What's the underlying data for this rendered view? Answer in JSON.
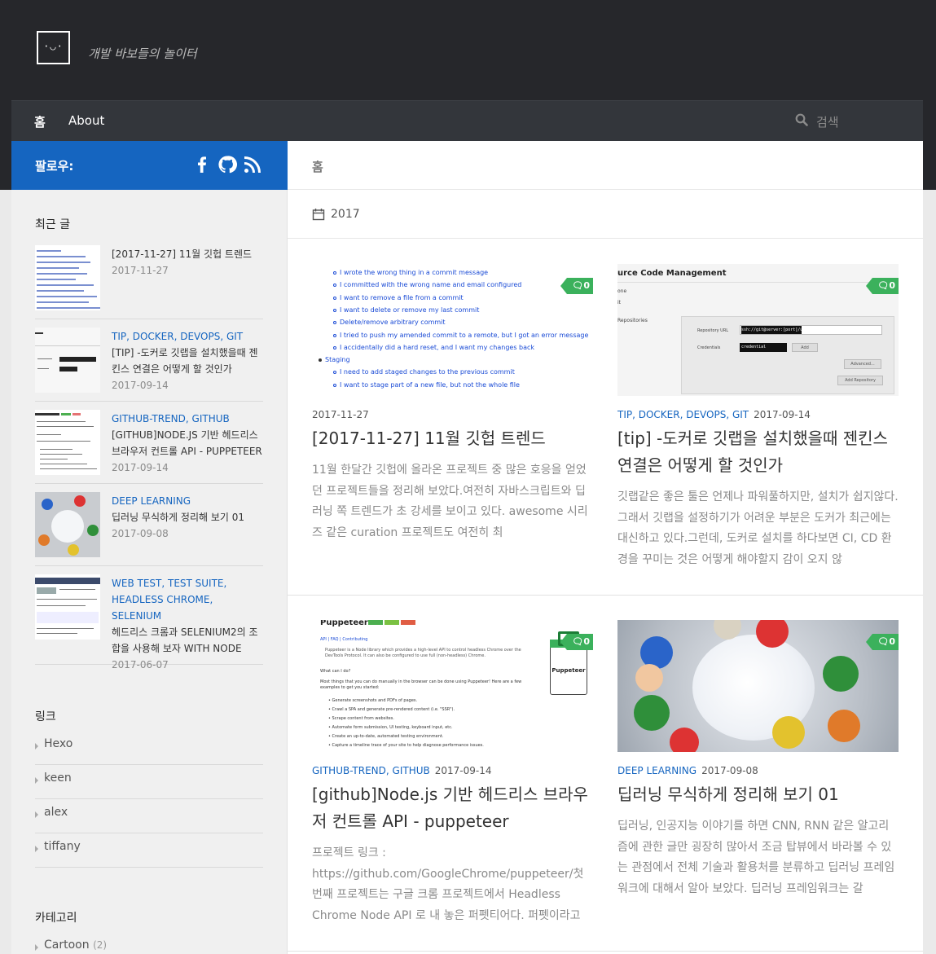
{
  "site": {
    "logo_text": "·◡·",
    "description": "개발 바보들의 놀이터"
  },
  "nav": {
    "home": "홈",
    "about": "About",
    "search_placeholder": "검색"
  },
  "follow": {
    "label": "팔로우:",
    "icons": [
      "facebook-icon",
      "github-icon",
      "rss-icon"
    ]
  },
  "sidebar": {
    "recent_heading": "최근 글",
    "recent": [
      {
        "category": "",
        "title": "[2017-11-27] 11월 깃헙 트렌드",
        "date": "2017-11-27"
      },
      {
        "category": "TIP, DOCKER, DEVOPS, GIT",
        "title": "[TIP] -도커로 깃랩을 설치했을때 젠킨스 연결은 어떻게 할 것인가",
        "date": "2017-09-14"
      },
      {
        "category": "GITHUB-TREND, GITHUB",
        "title": "[GITHUB]NODE.JS 기반 헤드리스 브라우저 컨트롤 API - PUPPETEER",
        "date": "2017-09-14"
      },
      {
        "category": "DEEP LEARNING",
        "title": "딥러닝 무식하게 정리해 보기 01",
        "date": "2017-09-08"
      },
      {
        "category": "WEB TEST, TEST SUITE, HEADLESS CHROME, SELENIUM",
        "title": "헤드리스 크롬과 SELENIUM2의 조합을 사용해 보자 WITH NODE",
        "date": "2017-06-07"
      }
    ],
    "links_heading": "링크",
    "links": [
      "Hexo",
      "keen",
      "alex",
      "tiffany"
    ],
    "categories_heading": "카테고리",
    "categories": [
      {
        "name": "Cartoon",
        "count": "(2)"
      }
    ]
  },
  "main": {
    "breadcrumb": "홈",
    "year": "2017",
    "posts": [
      {
        "category": "",
        "date": "2017-11-27",
        "comments": "0",
        "title": "[2017-11-27] 11월 깃헙 트렌드",
        "excerpt": "11월 한달간 깃헙에 올라온 프로젝트 중 많은 호응을 얻었던 프로젝트들을 정리해 보았다.여전히 자바스크립트와 딥러닝 쪽 트렌드가 초 강세를 보이고 있다. awesome 시리즈 같은 curation 프로젝트도 여전히 최"
      },
      {
        "category": "TIP, DOCKER, DEVOPS, GIT",
        "date": "2017-09-14",
        "comments": "0",
        "title": "[tip] -도커로 깃랩을 설치했을때 젠킨스 연결은 어떻게 할 것인가",
        "excerpt": "깃랩같은 좋은 툴은 언제나 파워풀하지만, 설치가 쉽지않다. 그래서 깃랩을 설정하기가 어려운 부분은 도커가 최근에는 대신하고 있다.그런데, 도커로 설치를 하다보면 CI, CD 환경을 꾸미는 것은 어떻게 해야할지 감이 오지 않"
      },
      {
        "category": "GITHUB-TREND, GITHUB",
        "date": "2017-09-14",
        "comments": "0",
        "title": "[github]Node.js 기반 헤드리스 브라우저 컨트롤 API - puppeteer",
        "excerpt": "프로젝트 링크 : https://github.com/GoogleChrome/puppeteer/첫번째 프로젝트는 구글 크롬 프로젝트에서 Headless Chrome Node API 로 내 놓은 퍼펫티어다. 퍼펫이라고"
      },
      {
        "category": "DEEP LEARNING",
        "date": "2017-09-08",
        "comments": "0",
        "title": "딥러닝 무식하게 정리해 보기 01",
        "excerpt": "딥러닝, 인공지능 이야기를 하면 CNN, RNN 같은 알고리즘에 관한 글만 굉장히 많아서 조금 탑뷰에서 바라볼 수 있는 관점에서 전체 기술과 활용처를 분류하고 딥러닝 프레임워크에 대해서 알아 보았다. 딥러닝 프레임워크는 갈"
      }
    ],
    "thumb_git_lines": [
      "I wrote the wrong thing in a commit message",
      "I committed with the wrong name and email configured",
      "I want to remove a file from a commit",
      "I want to delete or remove my last commit",
      "Delete/remove arbitrary commit",
      "I tried to push my amended commit to a remote, but I got an error message",
      "I accidentally did a hard reset, and I want my changes back",
      "Staging",
      "I need to add staged changes to the previous commit",
      "I want to stage part of a new file, but not the whole file"
    ],
    "thumb_scm": {
      "heading": "urce Code Management",
      "side": [
        "one",
        "it",
        "Repositories"
      ],
      "repo_label": "Repository URL",
      "repo_value": "ssh://git@server:[port]/url",
      "cred_label": "Credentials",
      "cred_value": "credential",
      "add": "Add",
      "advanced": "Advanced...",
      "add_repo": "Add Repository"
    },
    "thumb_puppeteer": {
      "title": "Puppeteer",
      "links": "API | FAQ | Contributing",
      "intro": "Puppeteer is a Node library which provides a high-level API to control headless Chrome over the DevTools Protocol. It can also be configured to use full (non-headless) Chrome.",
      "q": "What can I do?",
      "lead": "Most things that you can do manually in the browser can be done using Puppeteer! Here are a few examples to get you started:",
      "items": [
        "Generate screenshots and PDFs of pages.",
        "Crawl a SPA and generate pre-rendered content (i.e. \"SSR\").",
        "Scrape content from websites.",
        "Automate form submission, UI testing, keyboard input, etc.",
        "Create an up-to-date, automated testing environment.",
        "Capture a timeline trace of your site to help diagnose performance issues."
      ],
      "logo_text": "Puppeteer"
    }
  }
}
